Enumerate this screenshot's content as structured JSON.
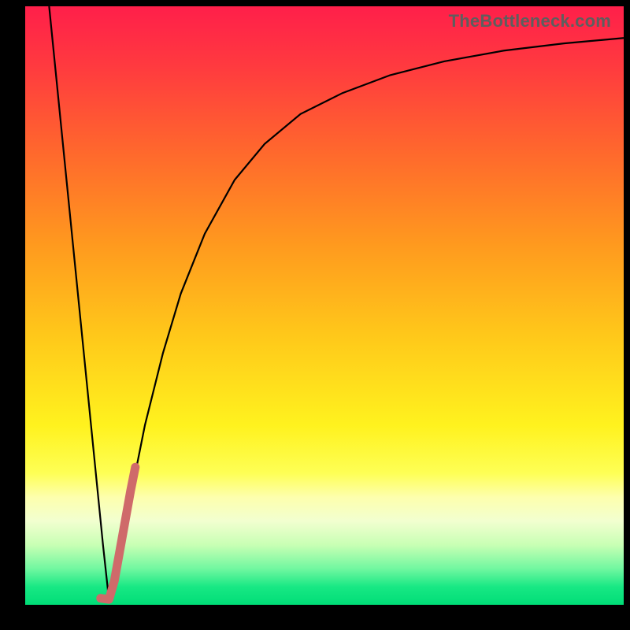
{
  "watermark": "TheBottleneck.com",
  "gradient_stops": [
    {
      "offset": 0.0,
      "color": "#ff1f4a"
    },
    {
      "offset": 0.1,
      "color": "#ff3a3f"
    },
    {
      "offset": 0.25,
      "color": "#ff6a2c"
    },
    {
      "offset": 0.4,
      "color": "#ff9a1e"
    },
    {
      "offset": 0.55,
      "color": "#ffc81a"
    },
    {
      "offset": 0.7,
      "color": "#fff21e"
    },
    {
      "offset": 0.78,
      "color": "#feff55"
    },
    {
      "offset": 0.82,
      "color": "#fdffad"
    },
    {
      "offset": 0.86,
      "color": "#f2ffd0"
    },
    {
      "offset": 0.9,
      "color": "#c8ffb4"
    },
    {
      "offset": 0.94,
      "color": "#70f7a0"
    },
    {
      "offset": 0.97,
      "color": "#18e884"
    },
    {
      "offset": 1.0,
      "color": "#00dd77"
    }
  ],
  "chart_data": {
    "type": "line",
    "title": "",
    "xlabel": "",
    "ylabel": "",
    "xlim": [
      0,
      100
    ],
    "ylim": [
      0,
      100
    ],
    "series": [
      {
        "name": "left-branch",
        "stroke": "#000000",
        "width": 2.2,
        "x": [
          4.0,
          5.0,
          6.0,
          7.0,
          8.0,
          9.0,
          10.0,
          11.0,
          12.0,
          13.0,
          14.0
        ],
        "values": [
          100.0,
          90.0,
          80.0,
          70.0,
          60.0,
          50.0,
          40.0,
          30.0,
          20.0,
          10.0,
          0.8
        ]
      },
      {
        "name": "right-branch",
        "stroke": "#000000",
        "width": 2.2,
        "x": [
          14.0,
          16.0,
          18.0,
          20.0,
          23.0,
          26.0,
          30.0,
          35.0,
          40.0,
          46.0,
          53.0,
          61.0,
          70.0,
          80.0,
          90.0,
          100.0
        ],
        "values": [
          0.8,
          10.0,
          20.0,
          30.0,
          42.0,
          52.0,
          62.0,
          71.0,
          77.0,
          82.0,
          85.5,
          88.5,
          90.8,
          92.6,
          93.8,
          94.7
        ]
      },
      {
        "name": "highlight-segment",
        "stroke": "#cf6a6a",
        "width": 11,
        "linecap": "round",
        "x": [
          12.6,
          13.3,
          14.0,
          14.9,
          15.8,
          16.7,
          17.6,
          18.4
        ],
        "values": [
          1.1,
          1.0,
          0.9,
          4.0,
          9.0,
          14.0,
          19.0,
          23.0
        ]
      }
    ]
  }
}
